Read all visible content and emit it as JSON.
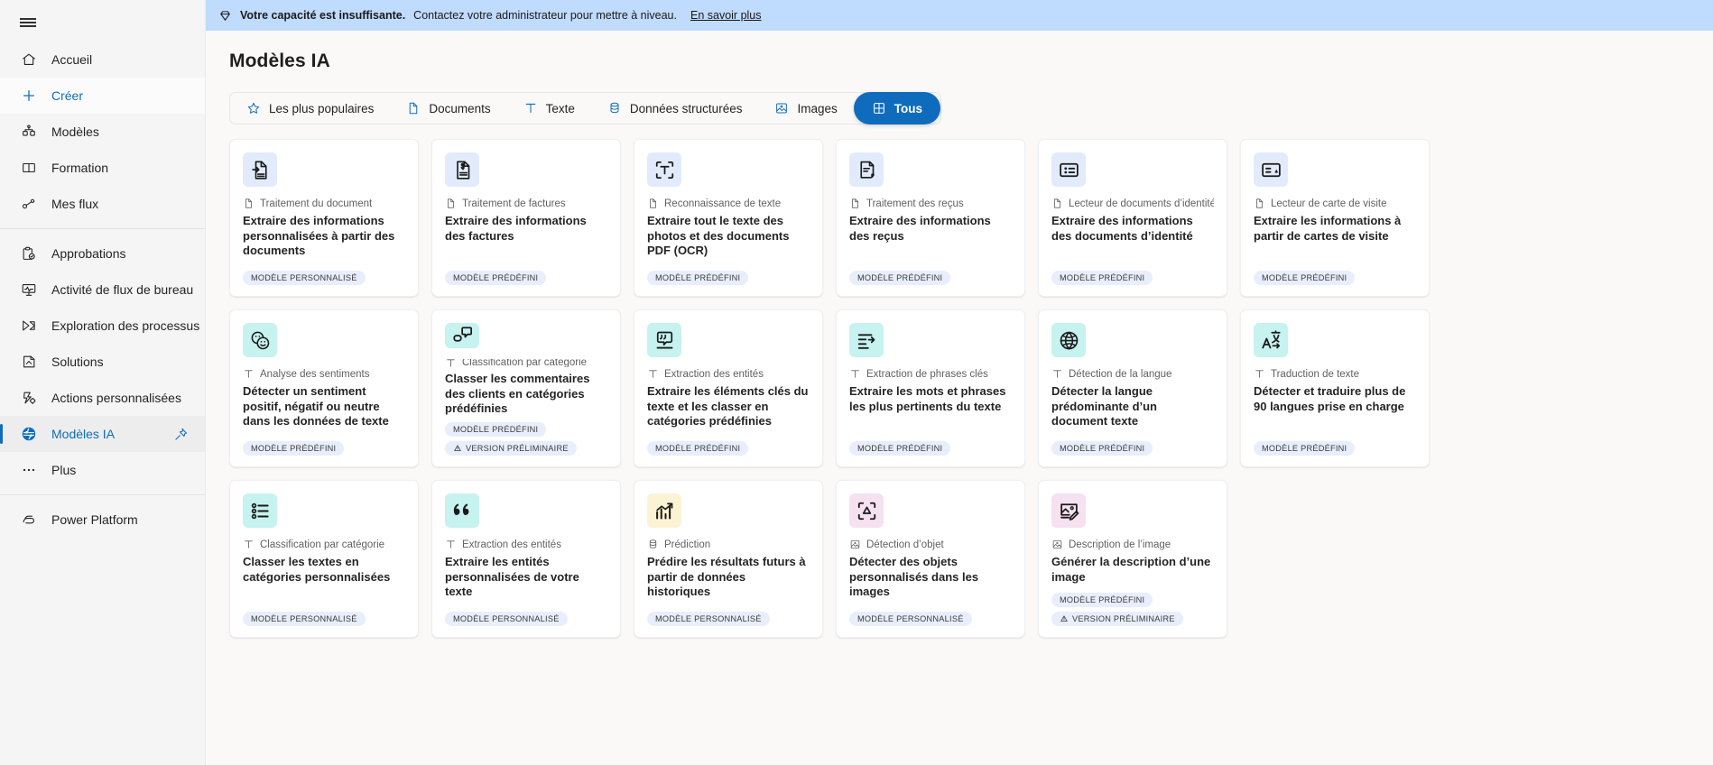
{
  "sidebar": {
    "menu_icon": "hamburger-icon",
    "items": [
      {
        "label": "Accueil",
        "icon": "home-icon",
        "state": "normal"
      },
      {
        "label": "Créer",
        "icon": "plus-icon",
        "state": "link"
      },
      {
        "label": "Modèles",
        "icon": "templates-icon",
        "state": "normal"
      },
      {
        "label": "Formation",
        "icon": "learn-icon",
        "state": "normal"
      },
      {
        "label": "Mes flux",
        "icon": "flows-icon",
        "state": "normal"
      }
    ],
    "items2": [
      {
        "label": "Approbations",
        "icon": "approvals-icon",
        "state": "normal"
      },
      {
        "label": "Activité de flux de bureau",
        "icon": "desktop-activity-icon",
        "state": "normal"
      },
      {
        "label": "Exploration des processus",
        "icon": "process-mining-icon",
        "state": "normal"
      },
      {
        "label": "Solutions",
        "icon": "solutions-icon",
        "state": "normal"
      },
      {
        "label": "Actions personnalisées",
        "icon": "custom-actions-icon",
        "state": "normal"
      },
      {
        "label": "Modèles IA",
        "icon": "ai-models-icon",
        "state": "selected",
        "pin": "pin-icon"
      },
      {
        "label": "Plus",
        "icon": "more-icon",
        "state": "normal"
      }
    ],
    "items3": [
      {
        "label": "Power Platform",
        "icon": "power-platform-icon",
        "state": "normal"
      }
    ]
  },
  "banner": {
    "icon": "diamond-icon",
    "bold_text": "Votre capacité est insuffisante.",
    "text": "Contactez votre administrateur pour mettre à niveau.",
    "link": "En savoir plus",
    "background": "#bfdbfe"
  },
  "header": {
    "title": "Modèles IA"
  },
  "tabs": {
    "accent_color": "#0f6cbd",
    "items": [
      {
        "label": "Les plus populaires",
        "icon": "star-icon",
        "active": false
      },
      {
        "label": "Documents",
        "icon": "document-icon",
        "active": false
      },
      {
        "label": "Texte",
        "icon": "text-icon",
        "active": false
      },
      {
        "label": "Données structurées",
        "icon": "database-icon",
        "active": false
      },
      {
        "label": "Images",
        "icon": "image-icon",
        "active": false
      },
      {
        "label": "Tous",
        "icon": "grid-icon",
        "active": true
      }
    ]
  },
  "labels": {
    "badge_custom": "MODÈLE PERSONNALISÉ",
    "badge_prebuilt": "MODÈLE PRÉDÉFINI",
    "badge_preview": "VERSION PRÉLIMINAIRE"
  },
  "cards": [
    {
      "icon": "document-extract-icon",
      "icon_bg": "blue",
      "kind_icon": "document-icon",
      "kind": "Traitement du document",
      "description": "Extraire des informations personnalisées à partir des documents",
      "badges": [
        "MODÈLE PERSONNALISÉ"
      ]
    },
    {
      "icon": "invoice-icon",
      "icon_bg": "blue",
      "kind_icon": "document-icon",
      "kind": "Traitement de factures",
      "description": "Extraire des informations des factures",
      "badges": [
        "MODÈLE PRÉDÉFINI"
      ]
    },
    {
      "icon": "text-recognition-icon",
      "icon_bg": "blue",
      "kind_icon": "document-icon",
      "kind": "Reconnaissance de texte",
      "description": "Extraire tout le texte des photos et des documents PDF (OCR)",
      "badges": [
        "MODÈLE PRÉDÉFINI"
      ]
    },
    {
      "icon": "receipt-icon",
      "icon_bg": "blue",
      "kind_icon": "document-icon",
      "kind": "Traitement des reçus",
      "description": "Extraire des informations des reçus",
      "badges": [
        "MODÈLE PRÉDÉFINI"
      ]
    },
    {
      "icon": "id-card-icon",
      "icon_bg": "blue",
      "kind_icon": "document-icon",
      "kind": "Lecteur de documents d’identité",
      "description": "Extraire des informations des documents d’identité",
      "badges": [
        "MODÈLE PRÉDÉFINI"
      ]
    },
    {
      "icon": "business-card-icon",
      "icon_bg": "blue",
      "kind_icon": "document-icon",
      "kind": "Lecteur de carte de visite",
      "description": "Extraire les informations à partir de cartes de visite",
      "badges": [
        "MODÈLE PRÉDÉFINI"
      ]
    },
    {
      "icon": "sentiment-icon",
      "icon_bg": "teal",
      "kind_icon": "text-icon",
      "kind": "Analyse des sentiments",
      "description": "Détecter un sentiment positif, négatif ou neutre dans les données de texte",
      "badges": [
        "MODÈLE PRÉDÉFINI"
      ]
    },
    {
      "icon": "category-classification-icon",
      "icon_bg": "teal",
      "kind_icon": "text-icon",
      "kind": "Classification par catégorie",
      "description": "Classer les commentaires des clients en catégories prédéfinies",
      "badges": [
        "MODÈLE PRÉDÉFINI",
        "VERSION PRÉLIMINAIRE"
      ]
    },
    {
      "icon": "entity-extraction-icon",
      "icon_bg": "teal",
      "kind_icon": "text-icon",
      "kind": "Extraction des entités",
      "description": "Extraire les éléments clés du texte et les classer en catégories prédéfinies",
      "badges": [
        "MODÈLE PRÉDÉFINI"
      ]
    },
    {
      "icon": "key-phrase-icon",
      "icon_bg": "teal",
      "kind_icon": "text-icon",
      "kind": "Extraction de phrases clés",
      "description": "Extraire les mots et phrases les plus pertinents du texte",
      "badges": [
        "MODÈLE PRÉDÉFINI"
      ]
    },
    {
      "icon": "globe-icon",
      "icon_bg": "teal",
      "kind_icon": "text-icon",
      "kind": "Détection de la langue",
      "description": "Détecter la langue prédominante d’un document texte",
      "badges": [
        "MODÈLE PRÉDÉFINI"
      ]
    },
    {
      "icon": "translate-icon",
      "icon_bg": "teal",
      "kind_icon": "text-icon",
      "kind": "Traduction de texte",
      "description": "Détecter et traduire plus de 90 langues prise en charge",
      "badges": [
        "MODÈLE PRÉDÉFINI"
      ]
    },
    {
      "icon": "list-icon",
      "icon_bg": "teal",
      "kind_icon": "text-icon",
      "kind": "Classification par catégorie",
      "description": "Classer les textes en catégories personnalisées",
      "badges": [
        "MODÈLE PERSONNALISÉ"
      ]
    },
    {
      "icon": "quote-icon",
      "icon_bg": "teal",
      "kind_icon": "text-icon",
      "kind": "Extraction des entités",
      "description": "Extraire les entités personnalisées de votre texte",
      "badges": [
        "MODÈLE PERSONNALISÉ"
      ]
    },
    {
      "icon": "prediction-chart-icon",
      "icon_bg": "yellow",
      "kind_icon": "database-icon",
      "kind": "Prédiction",
      "description": "Prédire les résultats futurs à partir de données historiques",
      "badges": [
        "MODÈLE PERSONNALISÉ"
      ]
    },
    {
      "icon": "object-detection-icon",
      "icon_bg": "pink",
      "kind_icon": "image-icon",
      "kind": "Détection d’objet",
      "description": "Détecter des objets personnalisés dans les images",
      "badges": [
        "MODÈLE PERSONNALISÉ"
      ]
    },
    {
      "icon": "image-description-icon",
      "icon_bg": "pink",
      "kind_icon": "image-icon",
      "kind": "Description de l’image",
      "description": "Générer la description d’une image",
      "badges": [
        "MODÈLE PRÉDÉFINI",
        "VERSION PRÉLIMINAIRE"
      ]
    }
  ]
}
